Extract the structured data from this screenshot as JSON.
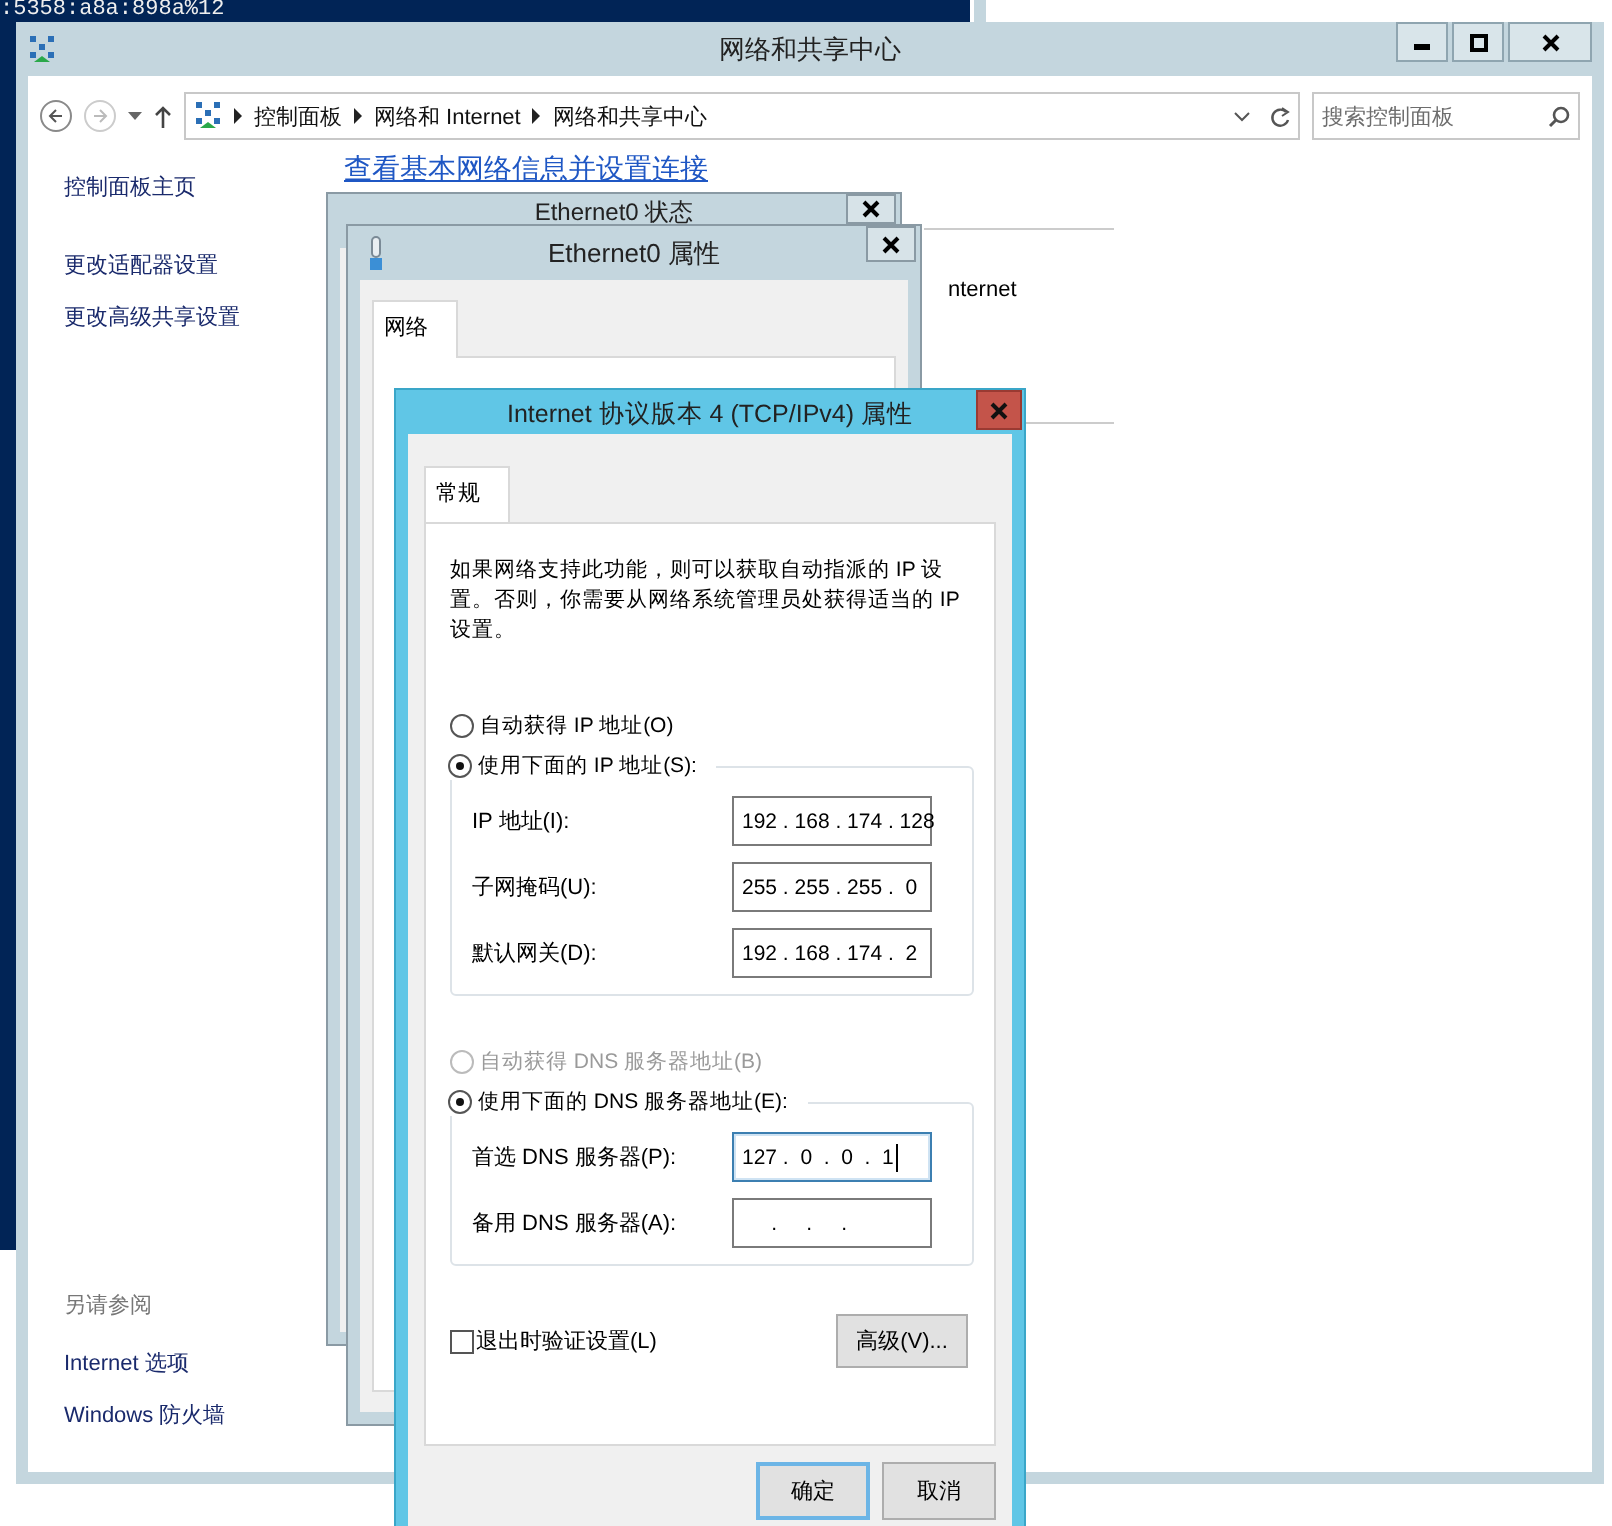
{
  "terminal": {
    "text": ":5358:a8a:898a%12"
  },
  "window": {
    "title": "网络和共享中心",
    "address": {
      "breadcrumbs": [
        "控制面板",
        "网络和 Internet",
        "网络和共享中心"
      ]
    },
    "search": {
      "placeholder": "搜索控制面板"
    },
    "sidebar": {
      "items": [
        "控制面板主页",
        "更改适配器设置",
        "更改高级共享设置"
      ],
      "see_also": {
        "title": "另请参阅",
        "items": [
          "Internet 选项",
          "Windows 防火墙"
        ]
      }
    },
    "heading": "查看基本网络信息并设置连接",
    "content_fragment": "nternet"
  },
  "status_dialog": {
    "title": "Ethernet0 状态"
  },
  "properties_dialog": {
    "title": "Ethernet0 属性",
    "tabs": [
      {
        "label": "网络",
        "selected": true
      }
    ]
  },
  "ipv4_dialog": {
    "title": "Internet 协议版本 4 (TCP/IPv4) 属性",
    "tabs": [
      {
        "label": "常规",
        "selected": true
      }
    ],
    "description": "如果网络支持此功能，则可以获取自动指派的 IP 设置。否则，你需要从网络系统管理员处获得适当的 IP 设置。",
    "ip_options": [
      {
        "label": "自动获得 IP 地址(O)",
        "selected": false,
        "disabled": false
      },
      {
        "label": "使用下面的 IP 地址(S):",
        "selected": true,
        "disabled": false
      }
    ],
    "ip_fields": [
      {
        "label": "IP 地址(I):",
        "value": "192 . 168 . 174 . 128",
        "focused": false
      },
      {
        "label": "子网掩码(U):",
        "value": "255 . 255 . 255 .  0",
        "focused": false
      },
      {
        "label": "默认网关(D):",
        "value": "192 . 168 . 174 .  2",
        "focused": false
      }
    ],
    "dns_options": [
      {
        "label": "自动获得 DNS 服务器地址(B)",
        "selected": false,
        "disabled": true
      },
      {
        "label": "使用下面的 DNS 服务器地址(E):",
        "selected": true,
        "disabled": false
      }
    ],
    "dns_fields": [
      {
        "label": "首选 DNS 服务器(P):",
        "value": "127 .  0  .  0  .  1",
        "focused": true
      },
      {
        "label": "备用 DNS 服务器(A):",
        "value": "     .     .     .",
        "focused": false
      }
    ],
    "validate": {
      "label": "退出时验证设置(L)",
      "checked": false
    },
    "advanced_button": "高级(V)...",
    "footer_buttons": [
      {
        "label": "确定",
        "default": true
      },
      {
        "label": "取消",
        "default": false
      }
    ]
  }
}
